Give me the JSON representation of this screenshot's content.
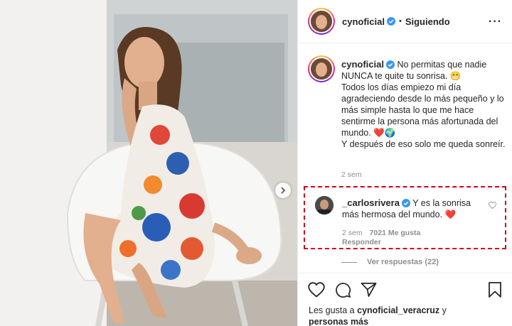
{
  "post": {
    "username": "cynoficial",
    "dot": "•",
    "follow_status": "Siguiendo",
    "more": "···"
  },
  "caption": {
    "username": "cynoficial",
    "text": "No permitas que nadie NUNCA te quite tu sonrisa. 😁\nTodos los días empiezo mi día agradeciendo desde lo más pequeño y lo más simple hasta lo que me hace sentirme la persona más afortunada del mundo. ❤️🌍\nY después de eso solo me queda sonreír.",
    "time": "2 sem"
  },
  "comment": {
    "username": "_carlosrivera",
    "text": "Y es la sonrisa más hermosa del mundo. ❤️",
    "time": "2 sem",
    "likes": "7021 Me gusta",
    "reply": "Responder"
  },
  "view_replies": "Ver respuestas (22)",
  "likes": {
    "prefix": "Les gusta a",
    "user": "cynoficial_veracruz",
    "mid": "y",
    "others": "personas más"
  },
  "icons": {
    "next": "chevron-right-icon",
    "verified": "verified-badge-icon",
    "heart": "heart-icon",
    "comment": "comment-icon",
    "share": "paper-plane-icon",
    "save": "bookmark-icon"
  },
  "colors": {
    "highlight_border": "#d0021b",
    "verified": "#3897f0",
    "muted": "#8e8e8e",
    "text": "#262626"
  }
}
